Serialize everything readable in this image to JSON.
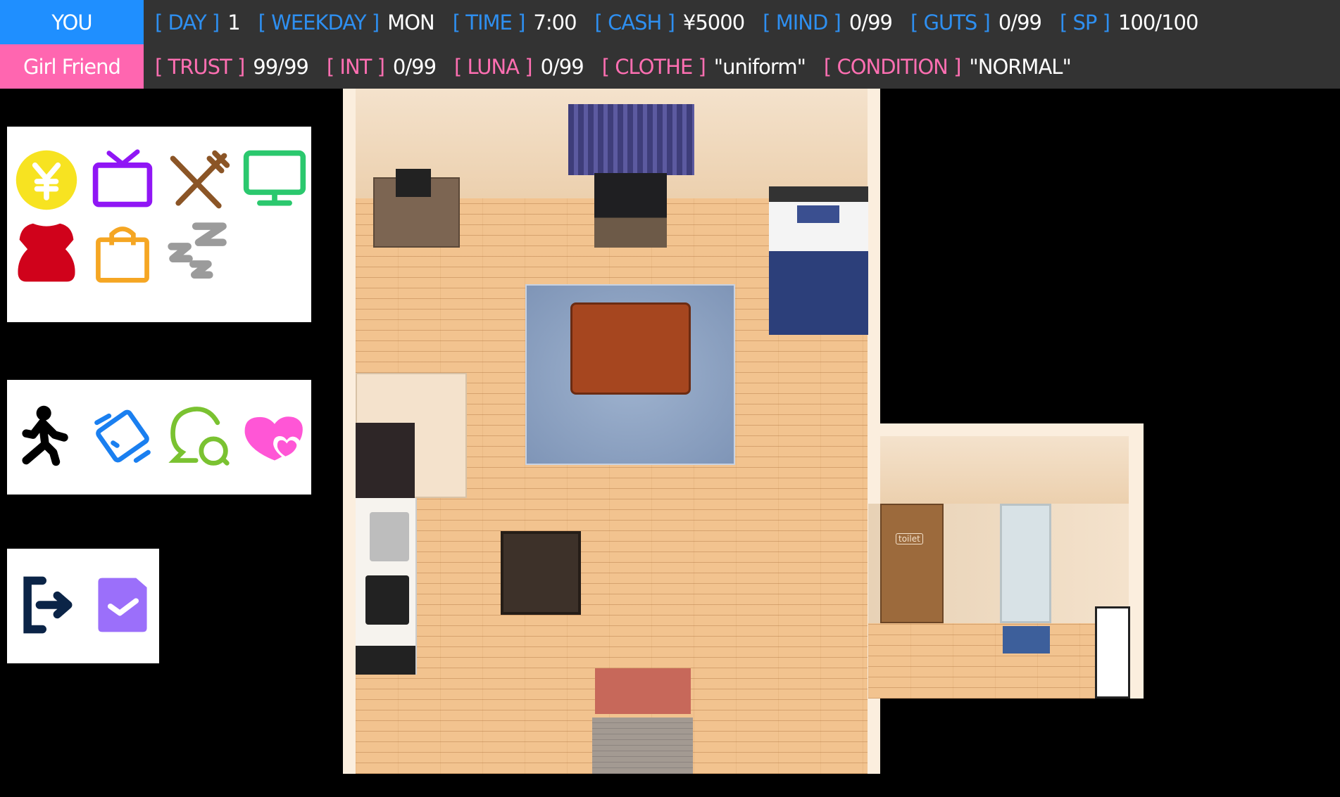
{
  "player": {
    "label": "YOU",
    "label_color": "#1f8fff",
    "stats": [
      {
        "key": "[ DAY ]",
        "value": "1"
      },
      {
        "key": "[ WEEKDAY ]",
        "value": "MON"
      },
      {
        "key": "[ TIME ]",
        "value": "7:00"
      },
      {
        "key": "[ CASH ]",
        "value": "¥5000"
      },
      {
        "key": "[ MIND ]",
        "value": "0/99"
      },
      {
        "key": "[ GUTS ]",
        "value": "0/99"
      },
      {
        "key": "[ SP ]",
        "value": "100/100"
      }
    ]
  },
  "girlfriend": {
    "label": "Girl Friend",
    "label_color": "#ff66b0",
    "stats": [
      {
        "key": "[ TRUST ]",
        "value": "99/99"
      },
      {
        "key": "[ INT ]",
        "value": "0/99"
      },
      {
        "key": "[ LUNA ]",
        "value": "0/99"
      },
      {
        "key": "[ CLOTHE ]",
        "value": "\"uniform\""
      },
      {
        "key": "[ CONDITION ]",
        "value": "\"NORMAL\""
      }
    ]
  },
  "action_panels": [
    [
      "yen-coin-icon",
      "tv-icon",
      "fork-knife-icon",
      "monitor-icon",
      "dress-icon",
      "shopping-bag-icon",
      "sleep-zzz-icon"
    ],
    [
      "walk-icon",
      "card-payment-icon",
      "chat-bubbles-icon",
      "hearts-icon"
    ],
    [
      "exit-icon",
      "task-check-icon"
    ]
  ],
  "room": {
    "toilet_sign": "toilet"
  }
}
